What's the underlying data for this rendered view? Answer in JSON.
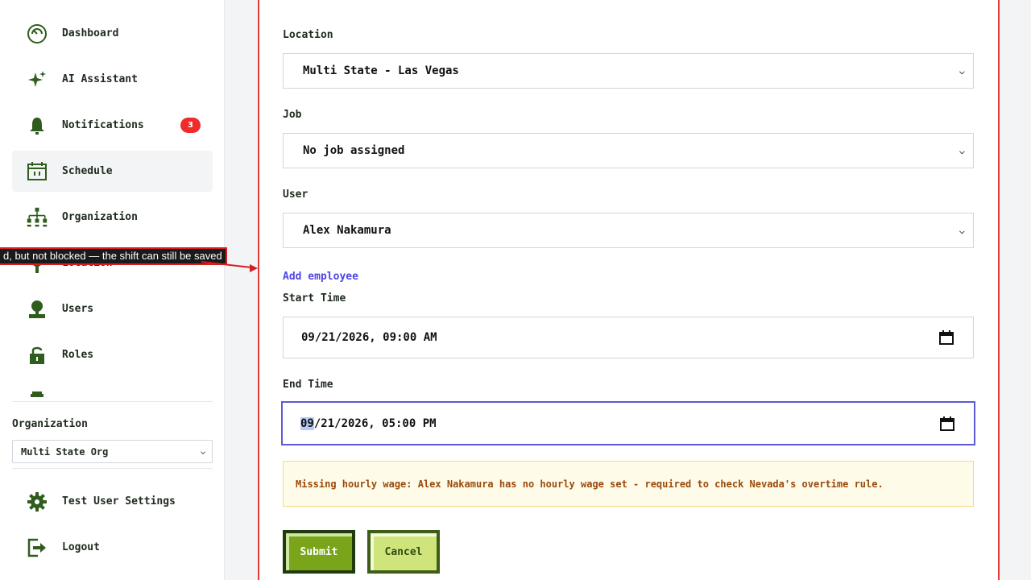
{
  "sidebar": {
    "items": [
      {
        "label": "Dashboard",
        "icon": "dashboard-icon"
      },
      {
        "label": "AI Assistant",
        "icon": "sparkle-icon"
      },
      {
        "label": "Notifications",
        "icon": "bell-icon",
        "badge": "3"
      },
      {
        "label": "Schedule",
        "icon": "calendar-icon",
        "active": true
      },
      {
        "label": "Organization",
        "icon": "org-chart-icon"
      },
      {
        "label": "Location",
        "icon": "location-pin-icon"
      },
      {
        "label": "Users",
        "icon": "user-icon"
      },
      {
        "label": "Roles",
        "icon": "padlock-icon"
      }
    ],
    "organization_label": "Organization",
    "organization_value": "Multi State Org",
    "settings_label": "Test User Settings",
    "logout_label": "Logout"
  },
  "form": {
    "location_label": "Location",
    "location_value": "Multi State - Las Vegas",
    "job_label": "Job",
    "job_value": "No job assigned",
    "user_label": "User",
    "user_value": "Alex Nakamura",
    "add_employee_label": "Add employee",
    "start_label": "Start Time",
    "start_value": "09/21/2026, 09:00 AM",
    "end_label": "End Time",
    "end_value_month": "09",
    "end_value_rest": "/21/2026, 05:00 PM",
    "warning": "Missing hourly wage: Alex Nakamura has no hourly wage set - required to check Nevada's overtime rule.",
    "submit_label": "Submit",
    "cancel_label": "Cancel"
  },
  "callout": {
    "text": "d, but not blocked — the shift can still be saved"
  },
  "colors": {
    "accent_green": "#2f5d1e",
    "badge_red": "#ef2b2b",
    "focus_blue": "#5b5bd6",
    "link": "#4f46e5",
    "warning_text": "#9a4a0b",
    "annotation_red": "#d61f1f"
  }
}
